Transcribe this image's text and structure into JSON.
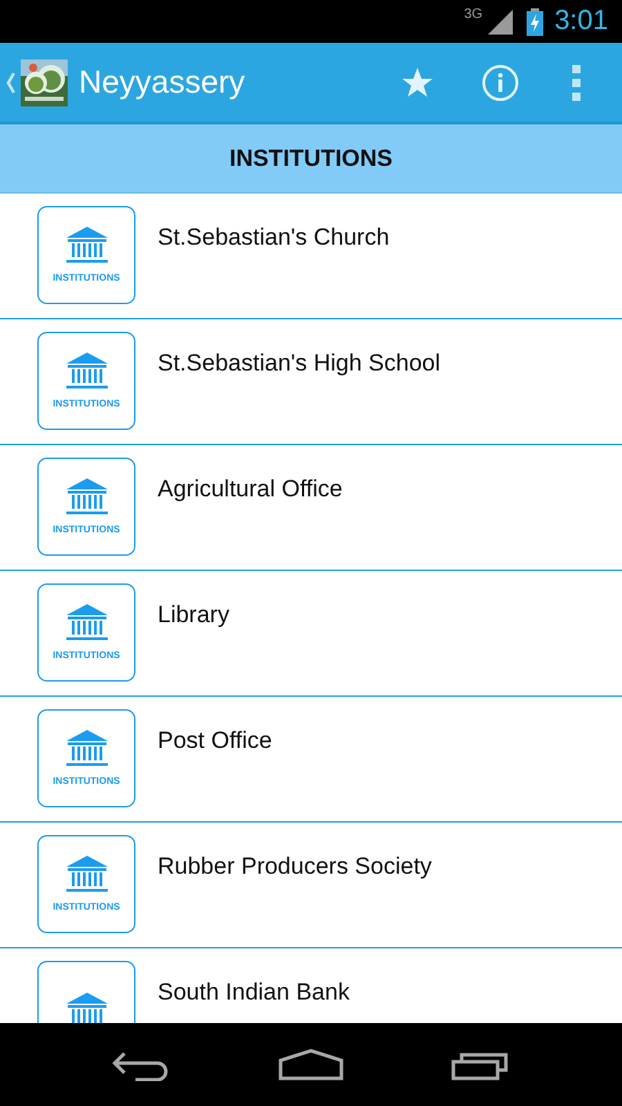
{
  "status_bar": {
    "network": "3G",
    "time": "3:01"
  },
  "action_bar": {
    "title": "Neyyassery"
  },
  "section_header": "INSTITUTIONS",
  "items": [
    {
      "name": "St.Sebastian's Church",
      "tile_label": "INSTITUTIONS"
    },
    {
      "name": "St.Sebastian's High School",
      "tile_label": "INSTITUTIONS"
    },
    {
      "name": "Agricultural Office",
      "tile_label": "INSTITUTIONS"
    },
    {
      "name": "Library",
      "tile_label": "INSTITUTIONS"
    },
    {
      "name": "Post Office",
      "tile_label": "INSTITUTIONS"
    },
    {
      "name": "Rubber Producers Society",
      "tile_label": "INSTITUTIONS"
    },
    {
      "name": "South Indian Bank"
    }
  ]
}
